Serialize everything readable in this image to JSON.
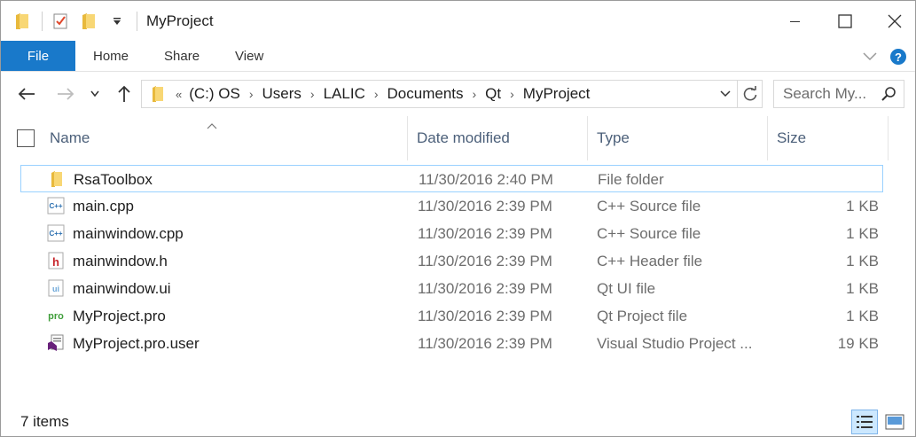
{
  "titlebar": {
    "title": "MyProject",
    "qat_icons": [
      "folder-icon",
      "properties-icon",
      "new-folder-icon",
      "customize-qat-icon"
    ],
    "controls": [
      "minimize-icon",
      "maximize-icon",
      "close-icon"
    ]
  },
  "ribbon": {
    "file_label": "File",
    "tabs": [
      {
        "label": "Home"
      },
      {
        "label": "Share"
      },
      {
        "label": "View"
      }
    ]
  },
  "nav": {
    "breadcrumb": {
      "overflow": "«",
      "crumbs": [
        "(C:) OS",
        "Users",
        "LALIC",
        "Documents",
        "Qt",
        "MyProject"
      ],
      "separator": "›"
    },
    "search_placeholder": "Search My..."
  },
  "columns": {
    "name": "Name",
    "date": "Date modified",
    "type": "Type",
    "size": "Size"
  },
  "files": [
    {
      "name": "RsaToolbox",
      "date": "11/30/2016 2:40 PM",
      "type": "File folder",
      "size": "",
      "icon": "folder-icon"
    },
    {
      "name": "main.cpp",
      "date": "11/30/2016 2:39 PM",
      "type": "C++ Source file",
      "size": "1 KB",
      "icon": "cpp-file-icon"
    },
    {
      "name": "mainwindow.cpp",
      "date": "11/30/2016 2:39 PM",
      "type": "C++ Source file",
      "size": "1 KB",
      "icon": "cpp-file-icon"
    },
    {
      "name": "mainwindow.h",
      "date": "11/30/2016 2:39 PM",
      "type": "C++ Header file",
      "size": "1 KB",
      "icon": "header-file-icon"
    },
    {
      "name": "mainwindow.ui",
      "date": "11/30/2016 2:39 PM",
      "type": "Qt UI file",
      "size": "1 KB",
      "icon": "ui-file-icon"
    },
    {
      "name": "MyProject.pro",
      "date": "11/30/2016 2:39 PM",
      "type": "Qt Project file",
      "size": "1 KB",
      "icon": "pro-file-icon"
    },
    {
      "name": "MyProject.pro.user",
      "date": "11/30/2016 2:39 PM",
      "type": "Visual Studio Project ...",
      "size": "19 KB",
      "icon": "visual-studio-file-icon"
    }
  ],
  "status": {
    "item_count": "7 items"
  },
  "colors": {
    "accent": "#1979ca",
    "header_text": "#4c607a",
    "muted_text": "#6d6d6d",
    "selection_border": "#99d1ff",
    "folder_yellow": "#f8d775"
  }
}
